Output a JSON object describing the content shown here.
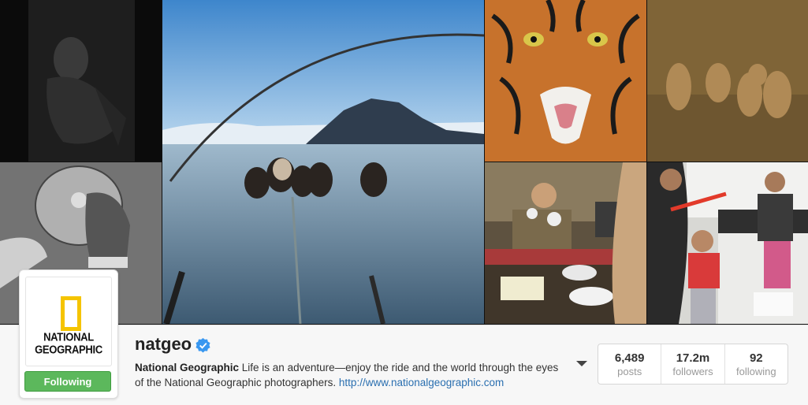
{
  "profile": {
    "username": "natgeo",
    "verified": true,
    "logo_text": "NATIONAL\nGEOGRAPHIC",
    "follow_label": "Following",
    "bio_name": "National Geographic",
    "bio_text": " Life is an adventure—enjoy the ride and the world through the eyes of the National Geographic photographers. ",
    "bio_link": "http://www.nationalgeographic.com"
  },
  "stats": [
    {
      "value": "6,489",
      "label": "posts"
    },
    {
      "value": "17.2m",
      "label": "followers"
    },
    {
      "value": "92",
      "label": "following"
    }
  ],
  "colors": {
    "follow_green": "#5cb85c",
    "link_blue": "#2a6fb0",
    "verified_blue": "#3897f0",
    "logo_yellow": "#f5c400"
  },
  "photos": [
    {
      "name": "photo-dark-portrait"
    },
    {
      "name": "photo-sled-dogs-ice"
    },
    {
      "name": "photo-tiger-face"
    },
    {
      "name": "photo-lion-cubs"
    },
    {
      "name": "photo-hand-with-disc"
    },
    {
      "name": "photo-kitchen-woman"
    },
    {
      "name": "photo-family-kitchen"
    }
  ]
}
